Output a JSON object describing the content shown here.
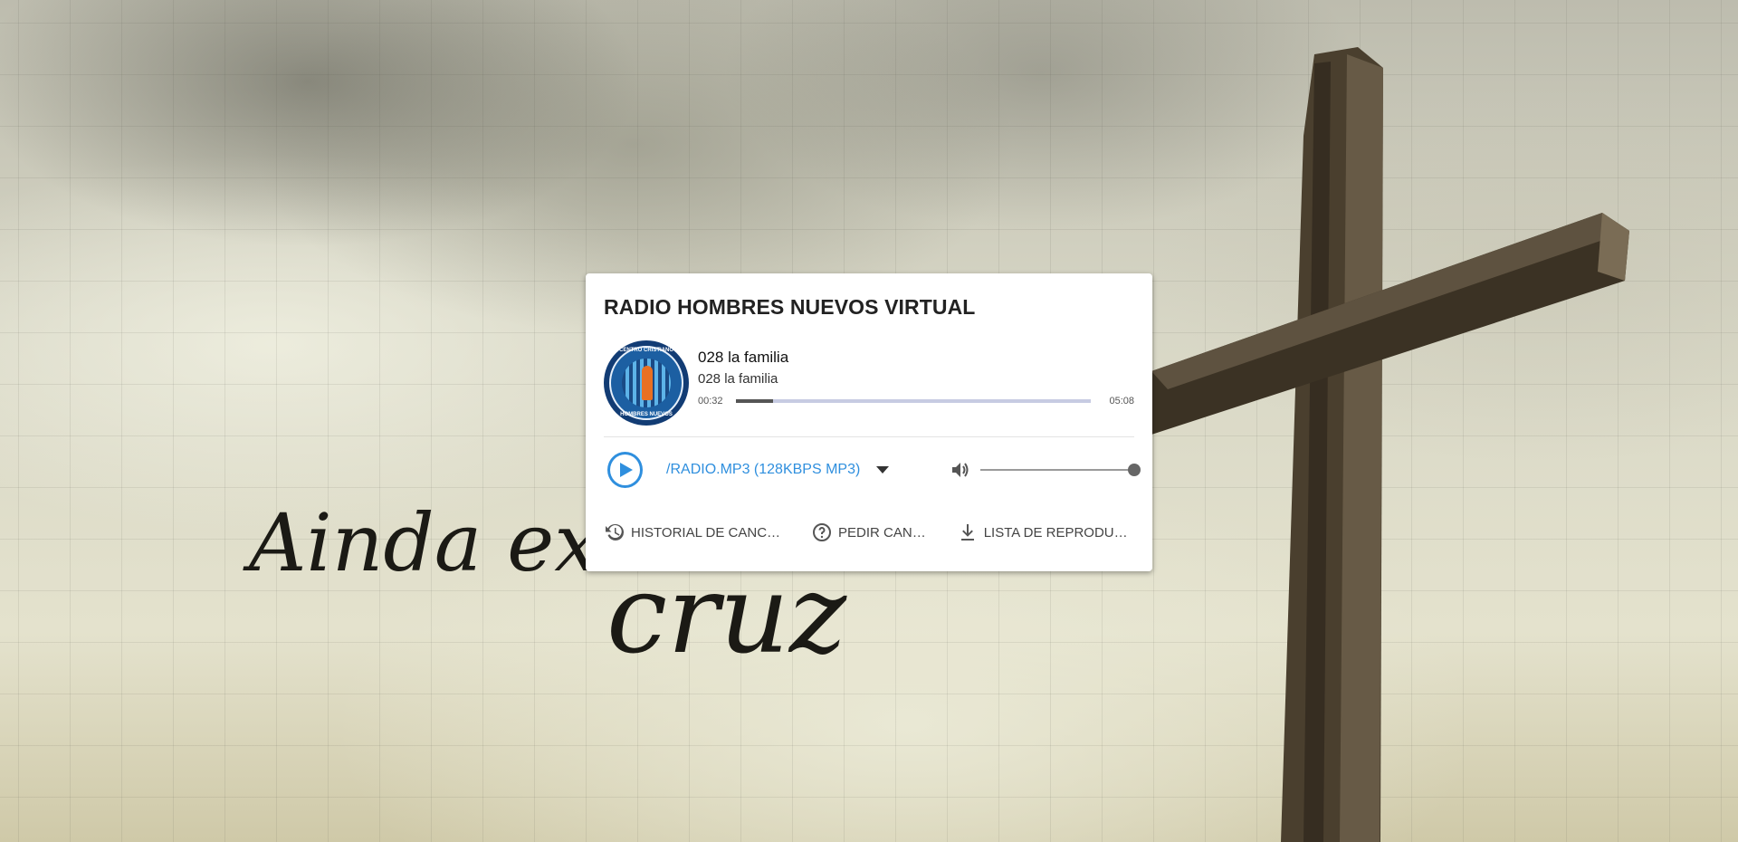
{
  "player": {
    "title": "RADIO HOMBRES NUEVOS VIRTUAL",
    "cover": {
      "text_top": "CENTRO CRISTIANO",
      "text_bottom": "HOMBRES NUEVOS"
    },
    "track": {
      "title": "028 la familia",
      "artist": "028 la familia",
      "elapsed": "00:32",
      "duration": "05:08",
      "progress": 0.104
    },
    "stream": {
      "selected": "/RADIO.MP3 (128KBPS MP3)"
    },
    "volume": {
      "level": 1.0
    },
    "actions": [
      {
        "label": "HISTORIAL DE CANC…",
        "icon": "history-icon"
      },
      {
        "label": "PEDIR CAN…",
        "icon": "help-circle-icon"
      },
      {
        "label": "LISTA DE REPRODU…",
        "icon": "download-icon"
      }
    ],
    "accent_color": "#2f8fde"
  },
  "background": {
    "script_text_1": "Ainda existe uma",
    "script_text_2": "cruz"
  }
}
